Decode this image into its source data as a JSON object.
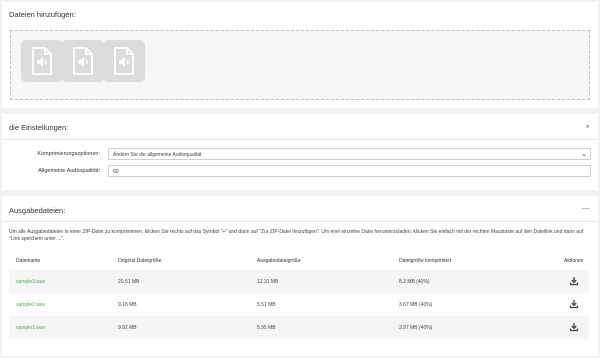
{
  "upload": {
    "title": "Dateien hinzufügen:",
    "tile_icon": "audio-file-icon"
  },
  "settings": {
    "title": "die Einstellungen:",
    "collapse_symbol": "×",
    "compression_label": "Komprimierungsoptionen:",
    "compression_value": "Ändern Sie die allgemeine Audioqualität",
    "quality_label": "Allgemeine Audioqualität:",
    "quality_value": "60"
  },
  "output": {
    "title": "Ausgabedateien:",
    "collapse_symbol": "—",
    "description": "Um alle Ausgabedateien in einer ZIP-Datei zu komprimieren, klicken Sie rechts auf das Symbol \"+\" und dann auf \"Zur ZIP-Datei hinzufügen\". Um eine einzelne Datei herunterzuladen, klicken Sie einfach mit der rechten Maustaste auf den Dateilink und dann auf \"Link speichern unter ...\".",
    "columns": [
      "Dateiname",
      "Original Dateigröße",
      "Ausgabedateigröße",
      "Dateigröße komprimiert",
      "Aktionen"
    ],
    "rows": [
      {
        "name": "sample3.wav",
        "original": "20.51 MB",
        "output": "12.31 MB",
        "compressed": "8.2 MB (40%)"
      },
      {
        "name": "sample2.wav",
        "original": "9.18 MB",
        "output": "5.51 MB",
        "compressed": "3.67 MB (40%)"
      },
      {
        "name": "sample1.wav",
        "original": "9.92 MB",
        "output": "5.95 MB",
        "compressed": "3.97 MB (40%)"
      }
    ],
    "action_icon": "download-icon"
  }
}
